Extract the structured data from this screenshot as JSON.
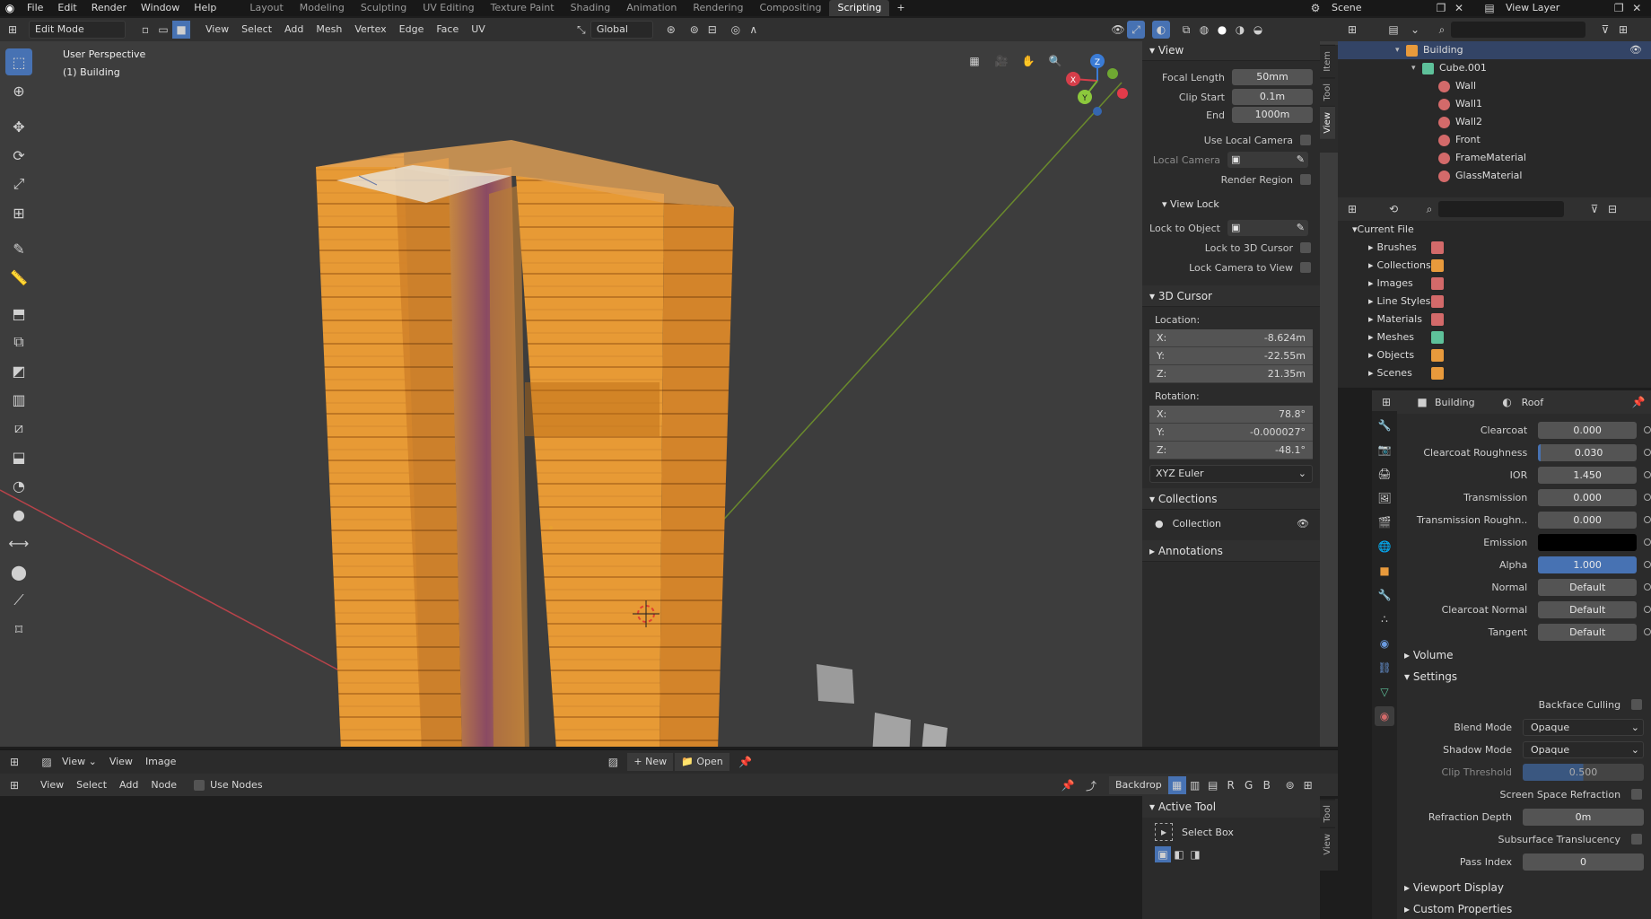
{
  "app": {
    "title": "Blender",
    "scene": "Scene",
    "view_layer": "View Layer"
  },
  "top_menu": [
    "File",
    "Edit",
    "Render",
    "Window",
    "Help"
  ],
  "workspaces": [
    "Layout",
    "Modeling",
    "Sculpting",
    "UV Editing",
    "Texture Paint",
    "Shading",
    "Animation",
    "Rendering",
    "Compositing",
    "Scripting"
  ],
  "active_workspace": "Scripting",
  "viewport_header": {
    "mode": "Edit Mode",
    "menus": [
      "View",
      "Select",
      "Add",
      "Mesh",
      "Vertex",
      "Edge",
      "Face",
      "UV"
    ],
    "transform_orientation": "Global"
  },
  "viewport_overlay": {
    "perspective": "User Perspective",
    "object": "(1) Building"
  },
  "gizmo_axes": {
    "x": "X",
    "y": "Y",
    "z": "Z"
  },
  "tools": [
    "select-box",
    "cursor",
    "move",
    "rotate",
    "scale",
    "transform",
    "annotate",
    "measure",
    "extrude",
    "inset",
    "bevel",
    "loop-cut",
    "knife",
    "poly-build",
    "spin",
    "smooth",
    "edge-slide",
    "shrink-fatten",
    "shear",
    "rip"
  ],
  "n_panel": {
    "view": {
      "title": "View",
      "focal_length_label": "Focal Length",
      "focal_length": "50mm",
      "clip_start_label": "Clip Start",
      "clip_start": "0.1m",
      "end_label": "End",
      "end": "1000m",
      "use_local_camera": "Use Local Camera",
      "local_camera": "Local Camera",
      "render_region": "Render Region"
    },
    "view_lock": {
      "title": "View Lock",
      "lock_to_object": "Lock to Object",
      "lock_to_cursor": "Lock to 3D Cursor",
      "lock_camera": "Lock Camera to View"
    },
    "cursor": {
      "title": "3D Cursor",
      "location_label": "Location:",
      "loc_x": "-8.624m",
      "loc_y": "-22.55m",
      "loc_z": "21.35m",
      "rotation_label": "Rotation:",
      "rot_x": "78.8°",
      "rot_y": "-0.000027°",
      "rot_z": "-48.1°",
      "mode": "XYZ Euler",
      "x": "X:",
      "y": "Y:",
      "z": "Z:"
    },
    "collections": {
      "title": "Collections",
      "item": "Collection"
    },
    "annotations": {
      "title": "Annotations"
    },
    "tabs": [
      "Item",
      "Tool",
      "View"
    ]
  },
  "outliner": {
    "items": [
      {
        "label": "Building",
        "level": 0,
        "type": "object",
        "color": "#e89a3c"
      },
      {
        "label": "Cube.001",
        "level": 1,
        "type": "mesh",
        "color": "#5ec19a"
      },
      {
        "label": "Wall",
        "level": 2,
        "type": "material",
        "color": "#d36a6a"
      },
      {
        "label": "Wall1",
        "level": 2,
        "type": "material",
        "color": "#d36a6a"
      },
      {
        "label": "Wall2",
        "level": 2,
        "type": "material",
        "color": "#d36a6a"
      },
      {
        "label": "Front",
        "level": 2,
        "type": "material",
        "color": "#d36a6a"
      },
      {
        "label": "FrameMaterial",
        "level": 2,
        "type": "material",
        "color": "#d36a6a"
      },
      {
        "label": "GlassMaterial",
        "level": 2,
        "type": "material",
        "color": "#d36a6a"
      }
    ]
  },
  "file_browser": {
    "root": "Current File",
    "items": [
      "Brushes",
      "Collections",
      "Images",
      "Line Styles",
      "Materials",
      "Meshes",
      "Objects",
      "Scenes"
    ]
  },
  "material_props": {
    "object": "Building",
    "material": "Roof",
    "rows": [
      {
        "label": "Clearcoat",
        "value": "0.000",
        "kind": "field"
      },
      {
        "label": "Clearcoat Roughness",
        "value": "0.030",
        "kind": "field"
      },
      {
        "label": "IOR",
        "value": "1.450",
        "kind": "field"
      },
      {
        "label": "Transmission",
        "value": "0.000",
        "kind": "field"
      },
      {
        "label": "Transmission Roughn..",
        "value": "0.000",
        "kind": "field"
      },
      {
        "label": "Emission",
        "value": "",
        "kind": "color"
      },
      {
        "label": "Alpha",
        "value": "1.000",
        "kind": "blue"
      },
      {
        "label": "Normal",
        "value": "Default",
        "kind": "field"
      },
      {
        "label": "Clearcoat Normal",
        "value": "Default",
        "kind": "field"
      },
      {
        "label": "Tangent",
        "value": "Default",
        "kind": "field"
      }
    ],
    "volume": "Volume",
    "settings": "Settings",
    "backface_culling": "Backface Culling",
    "blend_mode_label": "Blend Mode",
    "blend_mode": "Opaque",
    "shadow_mode_label": "Shadow Mode",
    "shadow_mode": "Opaque",
    "clip_threshold_label": "Clip Threshold",
    "clip_threshold": "0.500",
    "ssr": "Screen Space Refraction",
    "refraction_depth_label": "Refraction Depth",
    "refraction_depth": "0m",
    "subsurface": "Subsurface Translucency",
    "pass_index_label": "Pass Index",
    "pass_index": "0",
    "viewport_display": "Viewport Display",
    "custom_props": "Custom Properties"
  },
  "image_editor": {
    "menus": [
      "View",
      "View",
      "Image"
    ],
    "new": "New",
    "open": "Open"
  },
  "node_editor": {
    "menus": [
      "View",
      "Select",
      "Add",
      "Node"
    ],
    "use_nodes": "Use Nodes",
    "backdrop": "Backdrop",
    "channels": [
      "R",
      "G",
      "B"
    ]
  },
  "active_tool": {
    "title": "Active Tool",
    "tool": "Select Box",
    "tabs": [
      "Tool",
      "View"
    ]
  }
}
